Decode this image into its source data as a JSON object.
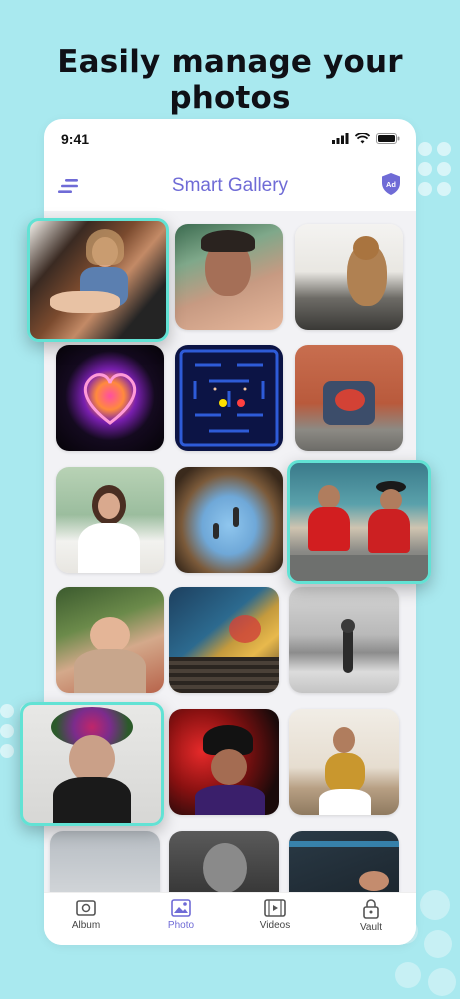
{
  "headline": "Easily manage your photos",
  "status_bar": {
    "time": "9:41"
  },
  "app_bar": {
    "title": "Smart Gallery",
    "ad_badge": "Ad"
  },
  "tabs": [
    {
      "label": "Album",
      "icon": "album-icon",
      "active": false
    },
    {
      "label": "Photo",
      "icon": "photo-icon",
      "active": true
    },
    {
      "label": "Videos",
      "icon": "videos-icon",
      "active": false
    },
    {
      "label": "Vault",
      "icon": "vault-icon",
      "active": false
    }
  ],
  "photos": [
    {
      "subject": "woman in car",
      "highlighted": true
    },
    {
      "subject": "man portrait"
    },
    {
      "subject": "cat"
    },
    {
      "subject": "neon heart"
    },
    {
      "subject": "pac-man maze"
    },
    {
      "subject": "street art wall"
    },
    {
      "subject": "woman in white"
    },
    {
      "subject": "lake reflection"
    },
    {
      "subject": "couple in red",
      "highlighted": true
    },
    {
      "subject": "woman with flowers"
    },
    {
      "subject": "stairway mural"
    },
    {
      "subject": "beach black and white"
    },
    {
      "subject": "flower crown woman",
      "highlighted": true
    },
    {
      "subject": "cyclist with helmet"
    },
    {
      "subject": "bride with veil"
    },
    {
      "subject": "sky"
    },
    {
      "subject": "woman in black and white"
    },
    {
      "subject": "laptop keyboard"
    }
  ],
  "colors": {
    "accent": "#6f6bd6",
    "highlight": "#5fe0d2",
    "background": "#a9e9ef"
  }
}
